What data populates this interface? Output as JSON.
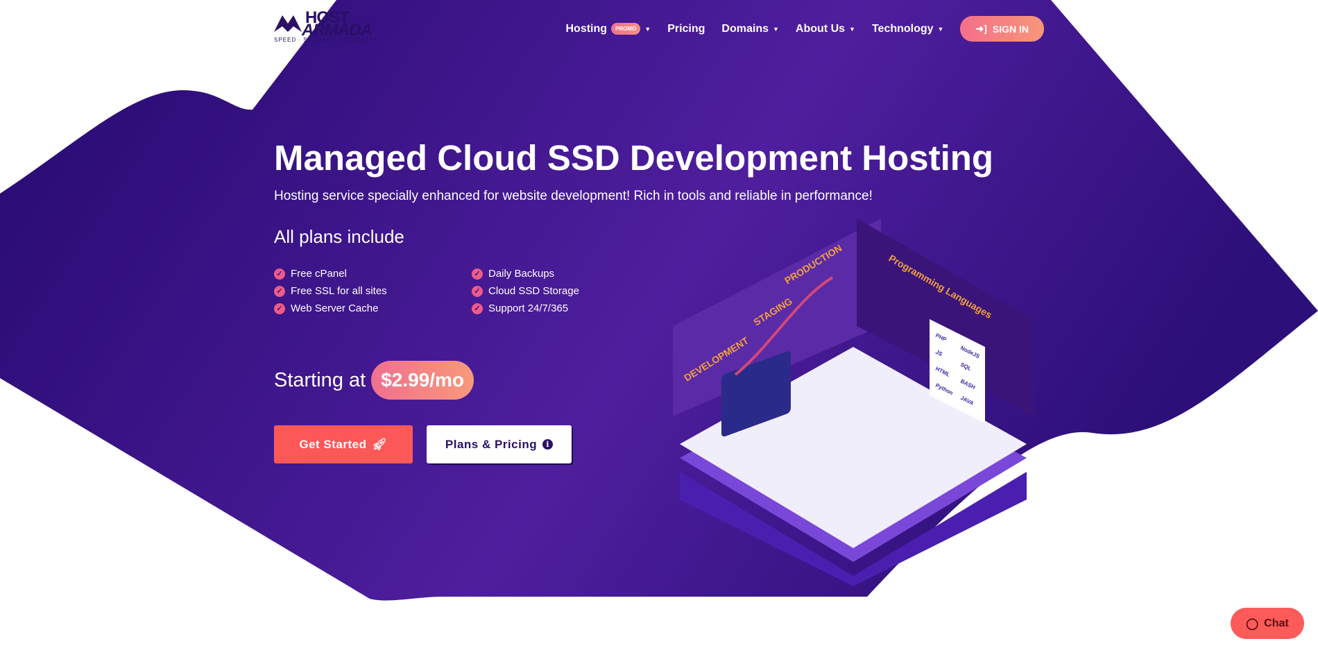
{
  "logo": {
    "line1": "HOST",
    "line2": "ARMADA",
    "tagline": "SPEED · SECURITY · STABILITY"
  },
  "nav": {
    "items": [
      {
        "label": "Hosting",
        "badge": "PROMO",
        "dropdown": true
      },
      {
        "label": "Pricing",
        "dropdown": false
      },
      {
        "label": "Domains",
        "dropdown": true
      },
      {
        "label": "About Us",
        "dropdown": true
      },
      {
        "label": "Technology",
        "dropdown": true
      }
    ],
    "signin": "SIGN IN"
  },
  "hero": {
    "title": "Managed Cloud SSD Development Hosting",
    "subtitle": "Hosting service specially enhanced for website development! Rich in tools and reliable in performance!",
    "plans_heading": "All plans include",
    "features_left": [
      "Free cPanel",
      "Free SSL for all sites",
      "Web Server Cache"
    ],
    "features_right": [
      "Daily Backups",
      "Cloud SSD Storage",
      "Support 24/7/365"
    ],
    "starting_at": "Starting at",
    "price": "$2.99/mo",
    "get_started": "Get Started",
    "plans_pricing": "Plans & Pricing"
  },
  "illustration": {
    "stages": [
      "DEVELOPMENT",
      "STAGING",
      "PRODUCTION"
    ],
    "panel_title": "Programming Languages",
    "languages": [
      "PHP",
      "NodeJS",
      "JS",
      "SQL",
      "HTML",
      "BASH",
      "Python",
      "JAVA"
    ]
  },
  "chat": {
    "label": "Chat"
  },
  "colors": {
    "purple_dark": "#2a0f75",
    "purple_light": "#5a23a8",
    "accent": "#fd5858",
    "pink": "#f07090"
  }
}
